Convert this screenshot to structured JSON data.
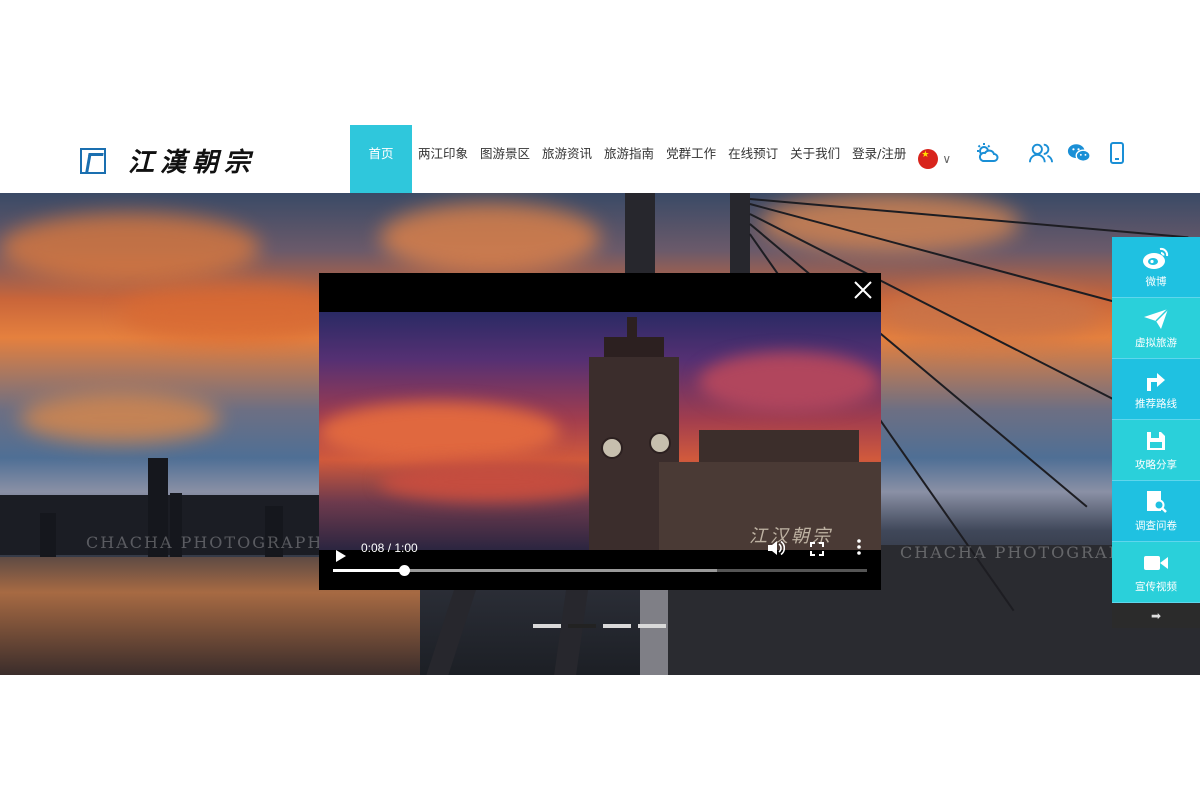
{
  "logo": {
    "text": "江漢朝宗"
  },
  "nav": {
    "items": [
      {
        "label": "首页"
      },
      {
        "label": "两江印象"
      },
      {
        "label": "图游景区"
      },
      {
        "label": "旅游资讯"
      },
      {
        "label": "旅游指南"
      },
      {
        "label": "党群工作"
      },
      {
        "label": "在线预订"
      },
      {
        "label": "关于我们"
      },
      {
        "label": "登录/注册"
      }
    ],
    "active_index": 0,
    "language_icon": "china-flag-icon"
  },
  "toolbar_icons": [
    "weather-icon",
    "users-icon",
    "wechat-icon",
    "mobile-icon"
  ],
  "banner": {
    "watermark_left": "CHACHA PHOTOGRAPHY",
    "watermark_right": "CHACHA PHOTOGRAPHY",
    "slide_count": 4,
    "active_slide": 1
  },
  "video": {
    "time": "0:08 / 1:00",
    "progress": 0.133,
    "buffered": 0.72,
    "watermark": "江汉朝宗"
  },
  "sidebar": {
    "items": [
      {
        "label": "微博",
        "icon": "weibo-icon"
      },
      {
        "label": "虚拟旅游",
        "icon": "paper-plane-icon"
      },
      {
        "label": "推荐路线",
        "icon": "route-arrow-icon"
      },
      {
        "label": "攻略分享",
        "icon": "save-icon"
      },
      {
        "label": "调查问卷",
        "icon": "survey-icon"
      },
      {
        "label": "宣传视频",
        "icon": "video-camera-icon"
      }
    ],
    "next_icon": "arrow-right-icon"
  },
  "colors": {
    "accent": "#2fc7dc",
    "sidebar": "#1fc1e1",
    "icon_blue": "#1a8fd6"
  }
}
